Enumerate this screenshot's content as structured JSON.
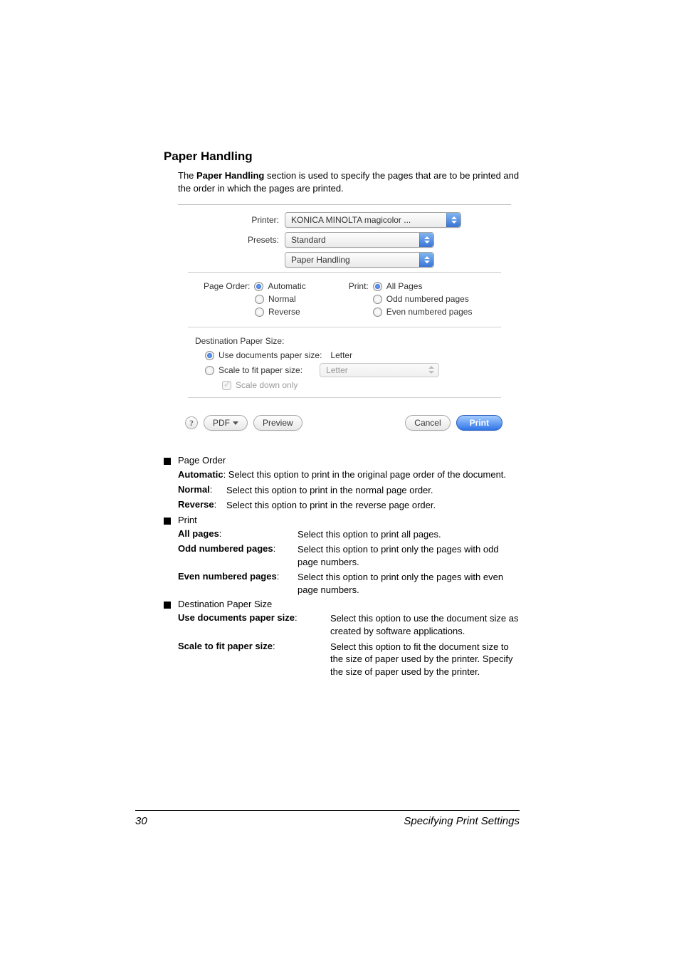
{
  "heading": "Paper Handling",
  "intro_pre": "The ",
  "intro_b": "Paper Handling",
  "intro_post": " section is used to specify the pages that are to be printed and the order in which the pages are printed.",
  "dialog": {
    "printer_label": "Printer:",
    "printer_value": "KONICA MINOLTA magicolor ...",
    "presets_label": "Presets:",
    "presets_value": "Standard",
    "panel_value": "Paper Handling",
    "page_order_label": "Page Order:",
    "po_auto": "Automatic",
    "po_normal": "Normal",
    "po_reverse": "Reverse",
    "print_label": "Print:",
    "pr_all": "All Pages",
    "pr_odd": "Odd numbered pages",
    "pr_even": "Even numbered pages",
    "dest_label": "Destination Paper Size:",
    "use_doc": "Use documents paper size:",
    "use_doc_val": "Letter",
    "scale_fit": "Scale to fit paper size:",
    "scale_val": "Letter",
    "scale_down": "Scale down only",
    "help": "?",
    "pdf": "PDF",
    "preview": "Preview",
    "cancel": "Cancel",
    "print": "Print"
  },
  "bullets": {
    "page_order": "Page Order",
    "auto_b": "Automatic",
    "auto_t": ": Select this option to print in the original page order of the document.",
    "normal_b": "Normal",
    "normal_t": "Select this option to print in the normal page order.",
    "reverse_b": "Reverse",
    "reverse_t": "Select this option to print in the reverse page order.",
    "print": "Print",
    "all_b": "All pages",
    "all_t": "Select this option to print all pages.",
    "odd_b": "Odd numbered pages",
    "odd_t": "Select this option to print only the pages with odd page numbers.",
    "even_b": "Even numbered pages",
    "even_t": "Select this option to print only the pages with even page numbers.",
    "dest": "Destination Paper Size",
    "use_b": "Use documents paper size",
    "use_t": "Select this option to use the document size as created by software applications.",
    "scale_b": "Scale to fit paper size",
    "scale_t": "Select this option to fit the document size to the size of paper used by the printer. Specify the size of paper used by the printer."
  },
  "footer": {
    "page": "30",
    "section": "Specifying Print Settings"
  }
}
